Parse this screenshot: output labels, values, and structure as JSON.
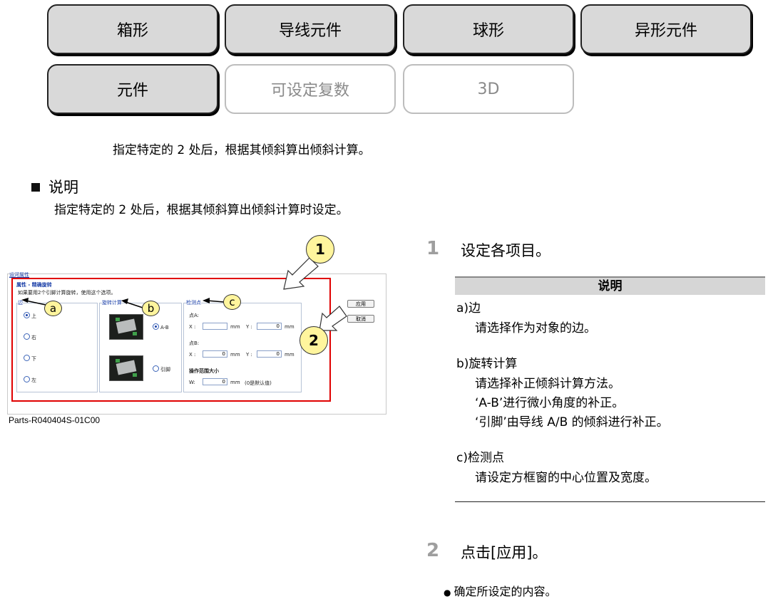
{
  "tabs": [
    {
      "label": "箱形",
      "active": true
    },
    {
      "label": "导线元件",
      "active": true
    },
    {
      "label": "球形",
      "active": true
    },
    {
      "label": "异形元件",
      "active": true
    },
    {
      "label": "元件",
      "active": true
    },
    {
      "label": "可设定复数",
      "active": false
    },
    {
      "label": "3D",
      "active": false
    }
  ],
  "summary": "指定特定的 2 处后，根据其倾斜算出倾斜计算。",
  "section": {
    "title": "说明",
    "body": "指定特定的 2 处后，根据其倾斜算出倾斜计算时设定。"
  },
  "screenshot": {
    "window_title": "运河属性",
    "panel_title": "属性 - 精确旋转",
    "hint": "如果要用2个引脚计算旋转，使用这个选项。",
    "edge": {
      "title": "边",
      "options": [
        "上",
        "右",
        "下",
        "左"
      ],
      "selected": "上"
    },
    "rotation": {
      "title": "旋转计算",
      "options": [
        "A-B",
        "引脚"
      ],
      "selected": "A-B"
    },
    "points": {
      "title": "检测点",
      "point_a": "点A:",
      "point_b": "点B:",
      "x_label": "X :",
      "y_label": "Y :",
      "unit": "mm",
      "ax": "",
      "ay": "0",
      "bx": "0",
      "by": "0",
      "range_title": "操作范围大小",
      "w_label": "W:",
      "w_value": "0",
      "w_note": "(0是默认值)"
    },
    "apply": "应用",
    "cancel": "取消"
  },
  "callouts": {
    "one": "1",
    "two": "2",
    "a": "a",
    "b": "b",
    "c": "c"
  },
  "figure_caption": "Parts-R040404S-01C00",
  "steps": [
    {
      "num": "1",
      "text": "设定各项目。"
    },
    {
      "num": "2",
      "text": "点击[应用]。"
    }
  ],
  "table": {
    "header": "说明",
    "items": [
      {
        "title": "a)边",
        "lines": [
          "请选择作为对象的边。"
        ]
      },
      {
        "title": "b)旋转计算",
        "lines": [
          "请选择补正倾斜计算方法。",
          "‘A-B’进行微小角度的补正。",
          "‘引脚’由导线 A/B 的倾斜进行补正。"
        ]
      },
      {
        "title": "c)检测点",
        "lines": [
          "请设定方框窗的中心位置及宽度。"
        ]
      }
    ]
  },
  "bullet": "确定所设定的内容。"
}
